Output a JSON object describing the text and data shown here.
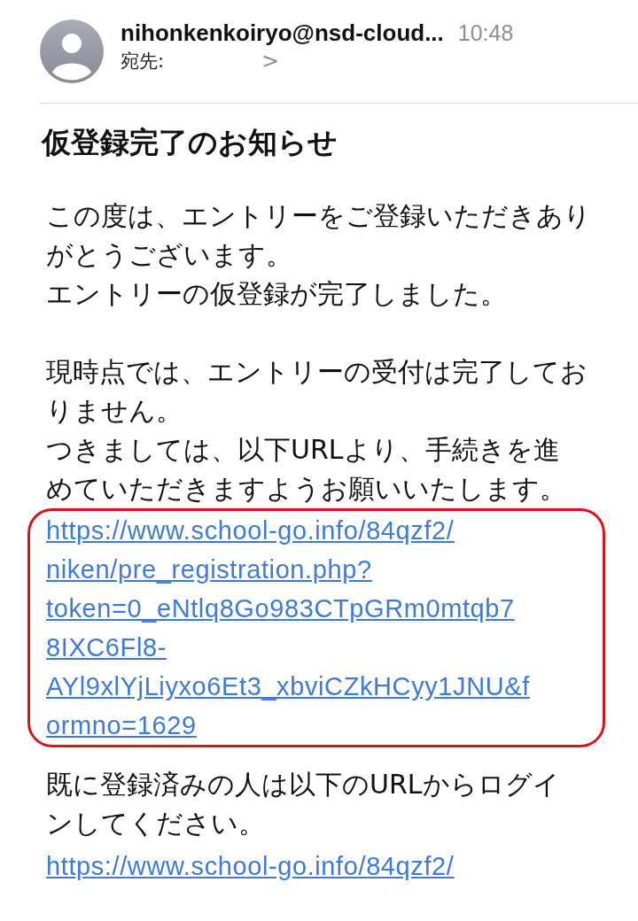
{
  "header": {
    "sender": "nihonkenkoiryo@nsd-cloud...",
    "time": "10:48",
    "to_label": "宛先:",
    "to_chevron": ">"
  },
  "subject": "仮登録完了のお知らせ",
  "body": [
    {
      "kind": "text",
      "lines": [
        "この度は、エントリーをご登録いただきあり",
        "がとうございます。",
        "エントリーの仮登録が完了しました。"
      ]
    },
    {
      "kind": "text",
      "lines": [
        "現時点では、エントリーの受付は完了してお",
        "りません。",
        "つきましては、以下URLより、手続きを進",
        "めていただきますようお願いいたします。"
      ]
    },
    {
      "kind": "link",
      "highlighted": true,
      "lines": [
        "https://www.school-go.info/84qzf2/",
        "niken/pre_registration.php?",
        "token=0_eNtlq8Go983CTpGRm0mtqb7",
        "8IXC6Fl8-",
        "AYl9xlYjLiyxo6Et3_xbviCZkHCyy1JNU&f",
        "ormno=1629"
      ]
    },
    {
      "kind": "text",
      "lines": [
        "既に登録済みの人は以下のURLからログイ",
        "ンしてください。"
      ]
    },
    {
      "kind": "link",
      "lines": [
        "https://www.school-go.info/84qzf2/"
      ]
    }
  ]
}
